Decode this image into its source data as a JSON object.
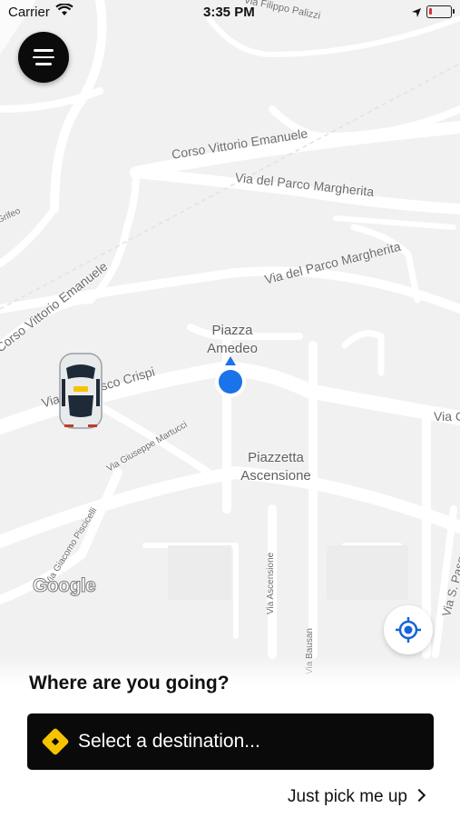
{
  "status_bar": {
    "carrier": "Carrier",
    "time": "3:35 PM"
  },
  "map": {
    "street_labels": {
      "corso_vittorio_top": "Corso Vittorio Emanuele",
      "parco_margherita_top": "Via del Parco Margherita",
      "parco_margherita_mid": "Via del Parco Margherita",
      "corso_vittorio_left": "Corso Vittorio Emanuele",
      "via_crispi": "Via Francesco Crispi",
      "martucci": "Via Giuseppe Martucci",
      "piscicelli": "Via Giacomo Piscicelli",
      "ascensione": "Via Ascensione",
      "s_pasquale": "Via S. Pasquale",
      "palizzi": "Via Filippo Palizzi",
      "grifeo": "Grifeo",
      "via_c": "Via C",
      "bausan": "Via Bausan"
    },
    "places": {
      "piazza_amedeo": "Piazza\nAmedeo",
      "piazzetta_ascensione": "Piazzetta\nAscensione"
    },
    "attribution": "Google"
  },
  "menu": {
    "icon": "hamburger-menu-icon"
  },
  "locate": {
    "icon": "my-location-icon",
    "color": "#1565d8"
  },
  "booking": {
    "question": "Where are you going?",
    "destination_placeholder": "Select a destination...",
    "pickup_link": "Just pick me up",
    "accent_color": "#f5c400"
  },
  "colors": {
    "location_dot": "#1a73e8",
    "button_bg": "#0a0a0a"
  }
}
